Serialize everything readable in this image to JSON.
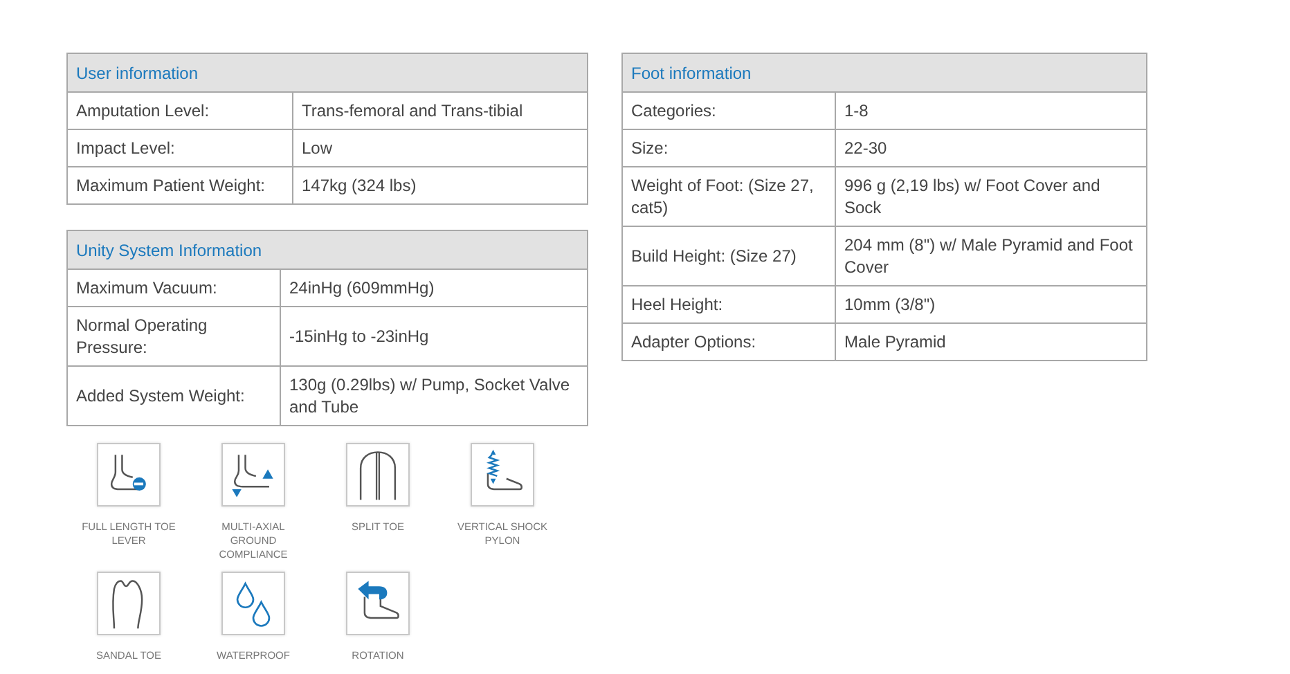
{
  "left_tables": [
    {
      "title": "User information",
      "rows": [
        {
          "label": "Amputation Level:",
          "value": "Trans-femoral and Trans-tibial"
        },
        {
          "label": "Impact Level:",
          "value": "Low"
        },
        {
          "label": "Maximum Patient Weight:",
          "value": "147kg (324 lbs)"
        }
      ]
    },
    {
      "title": "Unity System Information",
      "rows": [
        {
          "label": "Maximum Vacuum:",
          "value": "24inHg (609mmHg)"
        },
        {
          "label": "Normal Operating Pressure:",
          "value": "-15inHg to -23inHg"
        },
        {
          "label": "Added System Weight:",
          "value": "130g (0.29lbs) w/ Pump, Socket Valve and Tube"
        }
      ]
    }
  ],
  "right_tables": [
    {
      "title": "Foot information",
      "rows": [
        {
          "label": "Categories:",
          "value": "1-8"
        },
        {
          "label": "Size:",
          "value": "22-30"
        },
        {
          "label": "Weight of Foot: (Size 27, cat5)",
          "value": "996 g (2,19 lbs) w/ Foot Cover and Sock"
        },
        {
          "label": "Build Height: (Size 27)",
          "value": "204 mm (8\") w/ Male Pyramid and Foot Cover"
        },
        {
          "label": "Heel Height:",
          "value": "10mm (3/8\")"
        },
        {
          "label": "Adapter Options:",
          "value": "Male Pyramid"
        }
      ]
    }
  ],
  "features": [
    {
      "kind": "toe-lever",
      "label": "FULL LENGTH TOE LEVER"
    },
    {
      "kind": "ground",
      "label": "MULTI-AXIAL GROUND COMPLIANCE"
    },
    {
      "kind": "split",
      "label": "SPLIT TOE"
    },
    {
      "kind": "shock",
      "label": "VERTICAL SHOCK PYLON"
    },
    {
      "kind": "sandal",
      "label": "SANDAL TOE"
    },
    {
      "kind": "water",
      "label": "WATERPROOF"
    },
    {
      "kind": "rotation",
      "label": "ROTATION"
    }
  ]
}
